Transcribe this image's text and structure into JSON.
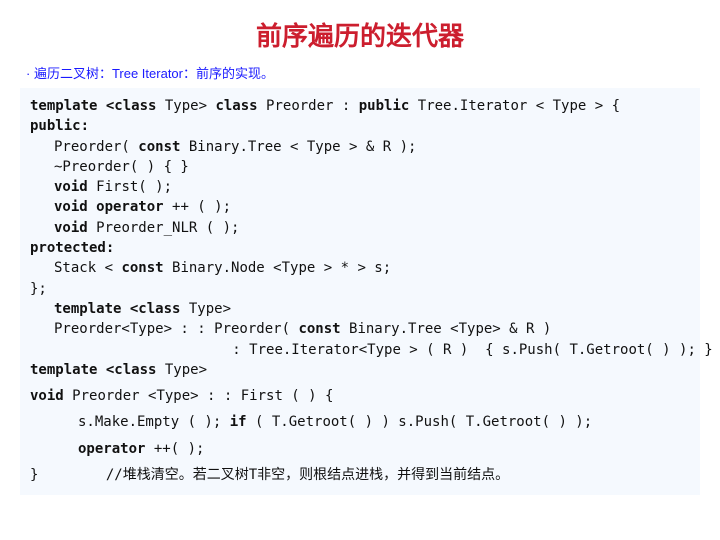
{
  "title": "前序遍历的迭代器",
  "subtitle": "· 遍历二叉树：Tree Iterator：前序的实现。",
  "code": {
    "l1a": "template ",
    "l1b": "<class",
    "l1c": " Type> ",
    "l1d": "class ",
    "l1e": "Preorder : ",
    "l1f": "public ",
    "l1g": "Tree.Iterator < Type > {",
    "l2": "public:",
    "l3a": "Preorder( ",
    "l3b": "const ",
    "l3c": "Binary.Tree < Type > & R );",
    "l4": "~Preorder( ) { }",
    "l5a": "void ",
    "l5b": "First( );",
    "l6a": "void operator ",
    "l6b": "++ ( );",
    "l7a": "void ",
    "l7b": "Preorder_NLR ( );",
    "l8": "protected:",
    "l9a": "Stack < ",
    "l9b": "const ",
    "l9c": "Binary.Node <Type > * > s;",
    "l10": "};",
    "l11a": "template ",
    "l11b": "<class ",
    "l11c": "Type>",
    "l12a": "Preorder<Type> : : Preorder( ",
    "l12b": "const ",
    "l12c": "Binary.Tree <Type> & R )",
    "l13": ": Tree.Iterator<Type > ( R )  { s.Push( T.Getroot( ) ); }",
    "l14a": "template ",
    "l14b": "<class ",
    "l14c": "Type>",
    "l15a": "void ",
    "l15b": "Preorder <Type> : : First ( ) {",
    "l16a": "s.Make.Empty ( ); ",
    "l16b": "if ",
    "l16c": "( T.Getroot( ) ) s.Push( T.Getroot( ) );",
    "l17a": "operator ",
    "l17b": "++( );",
    "l18a": "}",
    "l18b": "//堆栈清空。若二叉树T非空，则根结点进栈，并得到当前结点。"
  }
}
